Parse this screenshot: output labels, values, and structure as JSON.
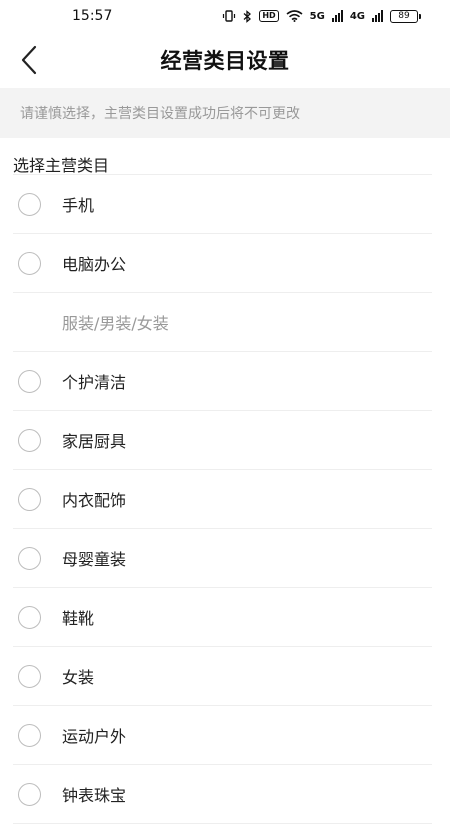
{
  "status_bar": {
    "time": "15:57",
    "network_a": "5G",
    "network_b": "4G",
    "hd_label": "HD",
    "battery": "89"
  },
  "header": {
    "back_icon": "chevron-left-icon",
    "title": "经营类目设置"
  },
  "notice": "请谨慎选择，主营类目设置成功后将不可更改",
  "section_title": "选择主营类目",
  "categories": [
    {
      "label": "手机",
      "selectable": true
    },
    {
      "label": "电脑办公",
      "selectable": true
    },
    {
      "label": "服装/男装/女装",
      "selectable": false
    },
    {
      "label": "个护清洁",
      "selectable": true
    },
    {
      "label": "家居厨具",
      "selectable": true
    },
    {
      "label": "内衣配饰",
      "selectable": true
    },
    {
      "label": "母婴童装",
      "selectable": true
    },
    {
      "label": "鞋靴",
      "selectable": true
    },
    {
      "label": "女装",
      "selectable": true
    },
    {
      "label": "运动户外",
      "selectable": true
    },
    {
      "label": "钟表珠宝",
      "selectable": true
    }
  ]
}
